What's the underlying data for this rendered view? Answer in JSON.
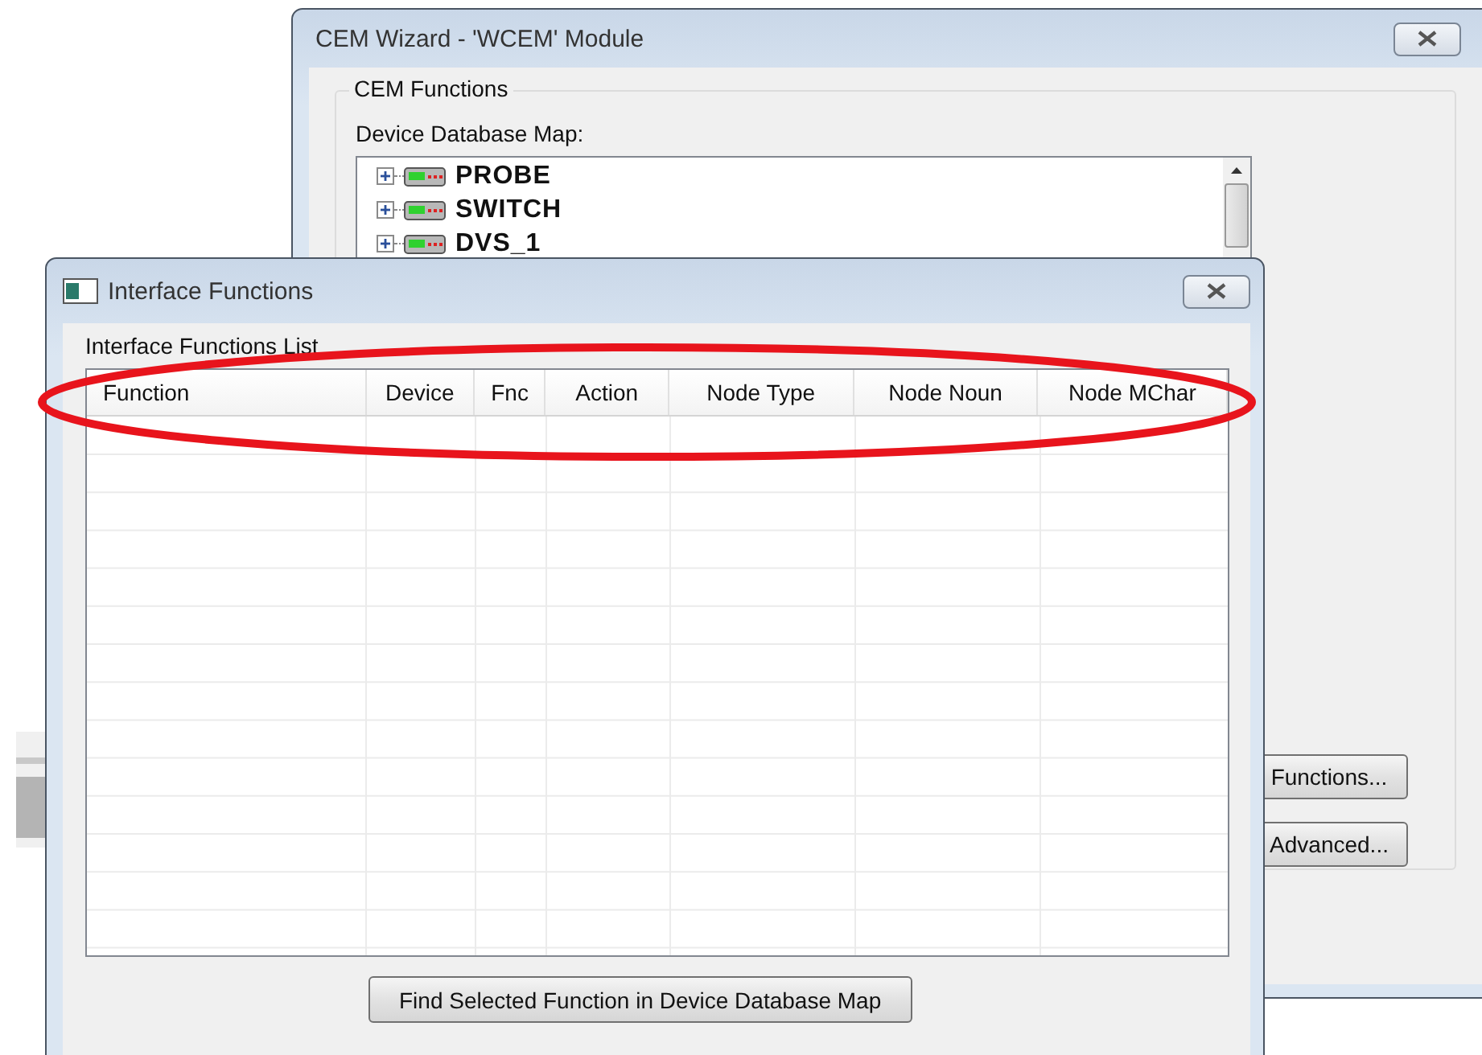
{
  "back_window": {
    "title": "CEM Wizard - 'WCEM' Module",
    "group_title": "CEM Functions",
    "tree_label": "Device Database Map:",
    "tree": [
      {
        "label": "PROBE",
        "expanded": false
      },
      {
        "label": "SWITCH",
        "expanded": false
      },
      {
        "label": "DVS_1",
        "expanded": false
      }
    ],
    "buttons": [
      "Functions...",
      "Advanced..."
    ]
  },
  "front_window": {
    "title": "Interface Functions",
    "list_label": "Interface Functions List",
    "columns": [
      "Function",
      "Device",
      "Fnc",
      "Action",
      "Node Type",
      "Node Noun",
      "Node MChar"
    ],
    "button": "Find Selected Function in Device Database Map"
  }
}
